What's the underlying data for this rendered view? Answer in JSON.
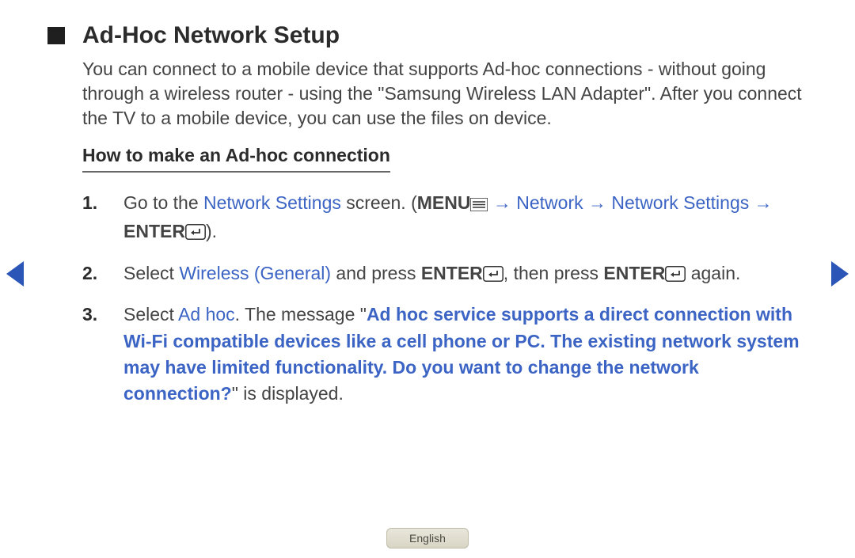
{
  "title": "Ad-Hoc Network Setup",
  "intro": "You can connect to a mobile device that supports Ad-hoc connections - without going through a wireless router - using the \"Samsung Wireless LAN Adapter\". After you connect the TV to a mobile device, you can use the files on device.",
  "subheading": "How to make an Ad-hoc connection",
  "steps": {
    "s1": {
      "num": "1.",
      "t1": "Go to the ",
      "network_settings": "Network Settings",
      "t2": " screen. (",
      "menu": "MENU",
      "arrow1": " → ",
      "network": "Network",
      "arrow2": " → ",
      "network_settings2": "Network Settings",
      "arrow3": " → ",
      "enter": "ENTER",
      "t3": ")."
    },
    "s2": {
      "num": "2.",
      "t1": "Select ",
      "wireless": "Wireless (General)",
      "t2": " and press ",
      "enter1": "ENTER",
      "t3": ", then press ",
      "enter2": "ENTER",
      "t4": " again."
    },
    "s3": {
      "num": "3.",
      "t1": "Select ",
      "adhoc": "Ad hoc",
      "t2": ". The message \"",
      "msg": "Ad hoc service supports a direct connection with Wi-Fi compatible devices like a cell phone or PC. The existing network system may have limited functionality. Do you want to change the network connection?",
      "t3": "\" is displayed."
    }
  },
  "language": "English"
}
